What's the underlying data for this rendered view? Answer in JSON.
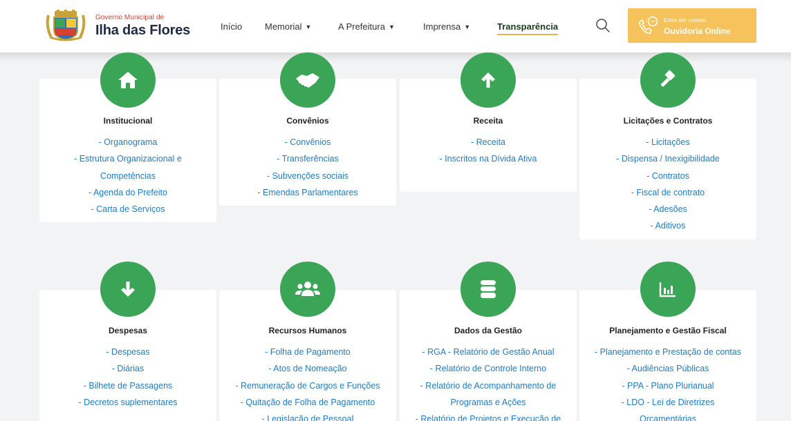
{
  "header": {
    "logo_small": "Governo Municipal de",
    "logo_big": "Ilha das Flores",
    "nav": [
      {
        "label": "Início",
        "caret": false,
        "active": false
      },
      {
        "label": "Memorial",
        "caret": true,
        "active": false
      },
      {
        "label": "A Prefeitura",
        "caret": true,
        "active": false
      },
      {
        "label": "Imprensa",
        "caret": true,
        "active": false
      },
      {
        "label": "Transparência",
        "caret": false,
        "active": true
      }
    ],
    "contact_small": "Entre em contato",
    "contact_big": "Ouvidoria Online"
  },
  "colors": {
    "accent_green": "#3aa556",
    "link_blue": "#1e7cc9",
    "contact_yellow": "#f5c25c"
  },
  "cards": [
    {
      "icon": "home-icon",
      "title": "Institucional",
      "links": [
        "- Organograma",
        "- Estrutura Organizacional e",
        "Competências",
        "- Agenda do Prefeito",
        "- Carta de Serviços"
      ]
    },
    {
      "icon": "handshake-icon",
      "title": "Convênios",
      "links": [
        "- Convênios",
        "- Transferências",
        "- Subvenções sociais",
        "- Emendas Parlamentares"
      ]
    },
    {
      "icon": "arrow-up-icon",
      "title": "Receita",
      "links": [
        "- Receita",
        "- Inscritos na Dívida Ativa"
      ]
    },
    {
      "icon": "gavel-icon",
      "title": "Licitações e Contratos",
      "links": [
        "- Licitações",
        "- Dispensa / Inexigibilidade",
        "- Contratos",
        "- Fiscal de contrato",
        "- Adesões",
        "- Aditivos"
      ]
    },
    {
      "icon": "arrow-down-icon",
      "title": "Despesas",
      "links": [
        "- Despesas",
        "- Diárias",
        "- Bilhete de Passagens",
        "- Decretos suplementares"
      ]
    },
    {
      "icon": "users-icon",
      "title": "Recursos Humanos",
      "links": [
        "- Folha de Pagamento",
        "- Atos de Nomeação",
        "- Remuneração de Cargos e Funções",
        "- Quitação de Folha de Pagamento",
        "- Legislação de Pessoal"
      ]
    },
    {
      "icon": "database-icon",
      "title": "Dados da Gestão",
      "links": [
        "- RGA - Relatório de Gestão Anual",
        "- Relatório de Controle Interno",
        "- Relatório de Acompanhamento de",
        "Programas e Ações",
        "- Relatório de Projetos e Execução de"
      ]
    },
    {
      "icon": "chart-icon",
      "title": "Planejamento e Gestão Fiscal",
      "links": [
        "- Planejamento e Prestação de contas",
        "- Audiências Públicas",
        "- PPA - Plano Plurianual",
        "- LDO - Lei de Diretrizes",
        "Orçamentárias"
      ]
    }
  ]
}
